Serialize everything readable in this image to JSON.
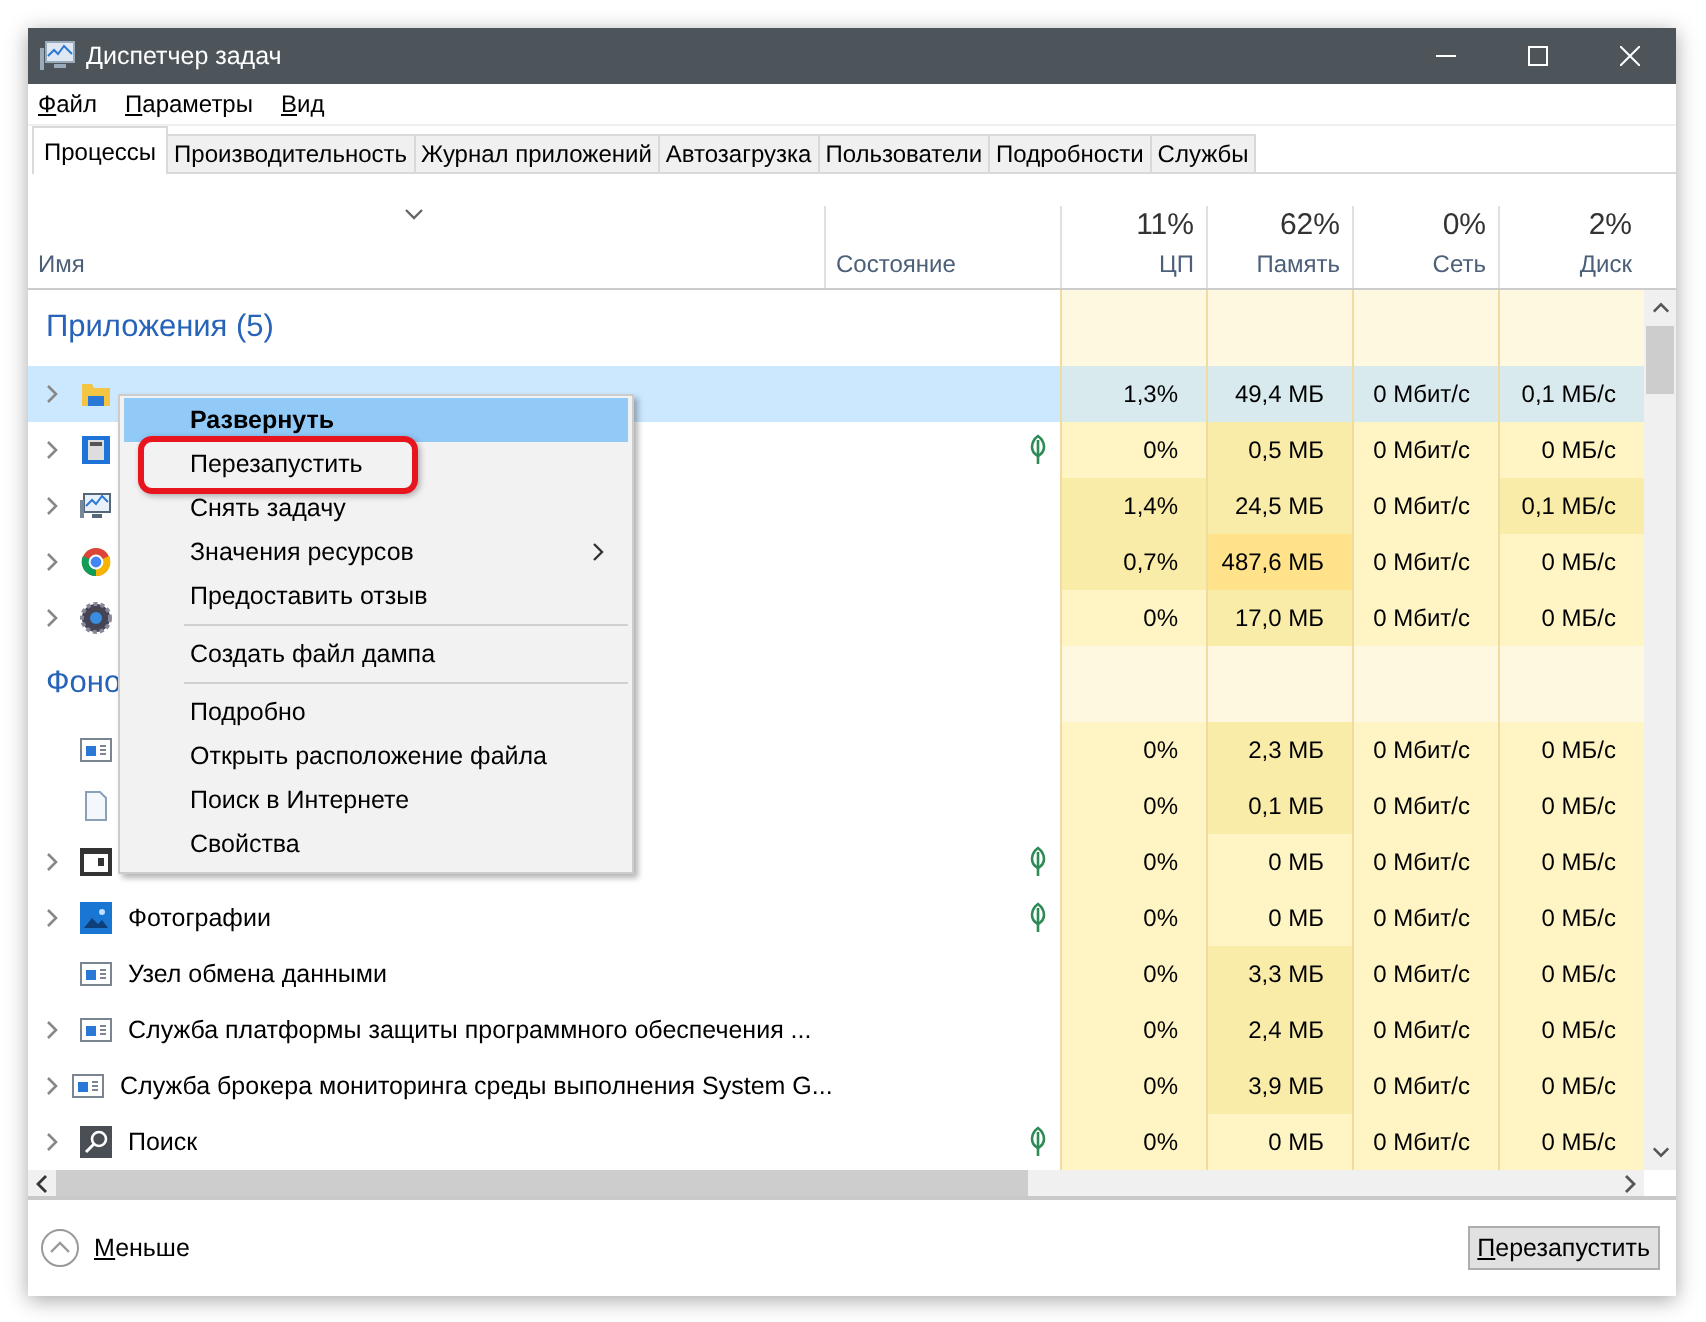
{
  "window": {
    "title": "Диспетчер задач"
  },
  "menu": [
    {
      "label": "Файл"
    },
    {
      "label": "Параметры"
    },
    {
      "label": "Вид"
    }
  ],
  "tabs": [
    {
      "label": "Процессы",
      "selected": true
    },
    {
      "label": "Производительность",
      "selected": false
    },
    {
      "label": "Журнал приложений",
      "selected": false
    },
    {
      "label": "Автозагрузка",
      "selected": false
    },
    {
      "label": "Пользователи",
      "selected": false
    },
    {
      "label": "Подробности",
      "selected": false
    },
    {
      "label": "Службы",
      "selected": false
    }
  ],
  "columns": [
    {
      "label": "Имя",
      "sorted": true
    },
    {
      "label": "Состояние",
      "sorted": false
    },
    {
      "label": "ЦП",
      "total": "11%",
      "sorted": false
    },
    {
      "label": "Память",
      "total": "62%",
      "sorted": false
    },
    {
      "label": "Сеть",
      "total": "0%",
      "sorted": false
    },
    {
      "label": "Диск",
      "total": "2%",
      "sorted": false
    }
  ],
  "groups": [
    {
      "title": "Приложения (5)",
      "rows": [
        {
          "kind": "folder",
          "expandable": true,
          "selected": true,
          "leaf": false,
          "cells": [
            {
              "text": "1,3%",
              "color": "#d8eaee"
            },
            {
              "text": "49,4 МБ",
              "color": "#d8eaee"
            },
            {
              "text": "0 Мбит/с",
              "color": "#d8eaee"
            },
            {
              "text": "0,1 МБ/с",
              "color": "#d8eaee"
            }
          ]
        },
        {
          "kind": "calculator",
          "expandable": true,
          "selected": false,
          "leaf": true,
          "cells": [
            {
              "text": "0%",
              "color": "#fff4c4"
            },
            {
              "text": "0,5 МБ",
              "color": "#f9eca8"
            },
            {
              "text": "0 Мбит/с",
              "color": "#fff4c4"
            },
            {
              "text": "0 МБ/с",
              "color": "#fff4c4"
            }
          ]
        },
        {
          "kind": "monitor",
          "expandable": true,
          "selected": false,
          "leaf": false,
          "cells": [
            {
              "text": "1,4%",
              "color": "#f9eca8"
            },
            {
              "text": "24,5 МБ",
              "color": "#f9eca8"
            },
            {
              "text": "0 Мбит/с",
              "color": "#fff4c4"
            },
            {
              "text": "0,1 МБ/с",
              "color": "#f9eca8"
            }
          ]
        },
        {
          "kind": "ring",
          "expandable": true,
          "selected": false,
          "leaf": false,
          "cells": [
            {
              "text": "0,7%",
              "color": "#f9eca8"
            },
            {
              "text": "487,6 МБ",
              "color": "#ffe28a"
            },
            {
              "text": "0 Мбит/с",
              "color": "#fff4c4"
            },
            {
              "text": "0 МБ/с",
              "color": "#fff4c4"
            }
          ]
        },
        {
          "kind": "gear",
          "expandable": true,
          "selected": false,
          "leaf": false,
          "cells": [
            {
              "text": "0%",
              "color": "#fff4c4"
            },
            {
              "text": "17,0 МБ",
              "color": "#f9eca8"
            },
            {
              "text": "0 Мбит/с",
              "color": "#fff4c4"
            },
            {
              "text": "0 МБ/с",
              "color": "#fff4c4"
            }
          ]
        }
      ]
    },
    {
      "title": "Фоно",
      "rows": [
        {
          "kind": "service",
          "expandable": false,
          "selected": false,
          "leaf": false,
          "cells": [
            {
              "text": "0%",
              "color": "#fff4c4"
            },
            {
              "text": "2,3 МБ",
              "color": "#f9eca8"
            },
            {
              "text": "0 Мбит/с",
              "color": "#fff4c4"
            },
            {
              "text": "0 МБ/с",
              "color": "#fff4c4"
            }
          ]
        },
        {
          "kind": "page",
          "expandable": false,
          "selected": false,
          "leaf": false,
          "cells": [
            {
              "text": "0%",
              "color": "#fff4c4"
            },
            {
              "text": "0,1 МБ",
              "color": "#f9eca8"
            },
            {
              "text": "0 Мбит/с",
              "color": "#fff4c4"
            },
            {
              "text": "0 МБ/с",
              "color": "#fff4c4"
            }
          ]
        },
        {
          "kind": "darkwindow",
          "expandable": true,
          "selected": false,
          "leaf": true,
          "cells": [
            {
              "text": "0%",
              "color": "#fff4c4"
            },
            {
              "text": "0 МБ",
              "color": "#fff4c4"
            },
            {
              "text": "0 Мбит/с",
              "color": "#fff4c4"
            },
            {
              "text": "0 МБ/с",
              "color": "#fff4c4"
            }
          ]
        },
        {
          "kind": "photo",
          "name": "Фотографии",
          "expandable": true,
          "selected": false,
          "leaf": true,
          "cells": [
            {
              "text": "0%",
              "color": "#fff4c4"
            },
            {
              "text": "0 МБ",
              "color": "#fff4c4"
            },
            {
              "text": "0 Мбит/с",
              "color": "#fff4c4"
            },
            {
              "text": "0 МБ/с",
              "color": "#fff4c4"
            }
          ]
        },
        {
          "kind": "service",
          "name": "Узел обмена данными",
          "expandable": false,
          "selected": false,
          "leaf": false,
          "cells": [
            {
              "text": "0%",
              "color": "#fff4c4"
            },
            {
              "text": "3,3 МБ",
              "color": "#f9eca8"
            },
            {
              "text": "0 Мбит/с",
              "color": "#fff4c4"
            },
            {
              "text": "0 МБ/с",
              "color": "#fff4c4"
            }
          ]
        },
        {
          "kind": "service",
          "name": "Служба платформы защиты программного обеспечения ...",
          "expandable": true,
          "selected": false,
          "leaf": false,
          "cells": [
            {
              "text": "0%",
              "color": "#fff4c4"
            },
            {
              "text": "2,4 МБ",
              "color": "#f9eca8"
            },
            {
              "text": "0 Мбит/с",
              "color": "#fff4c4"
            },
            {
              "text": "0 МБ/с",
              "color": "#fff4c4"
            }
          ]
        },
        {
          "kind": "service",
          "name": "Служба брокера мониторинга среды выполнения System G...",
          "expandable": true,
          "selected": false,
          "leaf": false,
          "cells": [
            {
              "text": "0%",
              "color": "#fff4c4"
            },
            {
              "text": "3,9 МБ",
              "color": "#f9eca8"
            },
            {
              "text": "0 Мбит/с",
              "color": "#fff4c4"
            },
            {
              "text": "0 МБ/с",
              "color": "#fff4c4"
            }
          ]
        },
        {
          "kind": "search",
          "name": "Поиск",
          "expandable": true,
          "selected": false,
          "leaf": true,
          "cells": [
            {
              "text": "0%",
              "color": "#fff4c4"
            },
            {
              "text": "0 МБ",
              "color": "#fff4c4"
            },
            {
              "text": "0 Мбит/с",
              "color": "#fff4c4"
            },
            {
              "text": "0 МБ/с",
              "color": "#fff4c4"
            }
          ]
        }
      ]
    }
  ],
  "context_menu": [
    {
      "kind": "item",
      "label": "Развернуть",
      "selected": true,
      "default": true,
      "highlighted": false
    },
    {
      "kind": "item",
      "label": "Перезапустить",
      "selected": false,
      "default": false,
      "highlighted": true
    },
    {
      "kind": "item",
      "label": "Снять задачу",
      "selected": false,
      "default": false,
      "highlighted": false
    },
    {
      "kind": "submenu",
      "label": "Значения ресурсов",
      "selected": false,
      "default": false,
      "highlighted": false
    },
    {
      "kind": "item",
      "label": "Предоставить отзыв",
      "selected": false,
      "default": false,
      "highlighted": false
    },
    {
      "kind": "separator"
    },
    {
      "kind": "item",
      "label": "Создать файл дампа",
      "selected": false,
      "default": false,
      "highlighted": false
    },
    {
      "kind": "separator"
    },
    {
      "kind": "item",
      "label": "Подробно",
      "selected": false,
      "default": false,
      "highlighted": false
    },
    {
      "kind": "item",
      "label": "Открыть расположение файла",
      "selected": false,
      "default": false,
      "highlighted": false
    },
    {
      "kind": "item",
      "label": "Поиск в Интернете",
      "selected": false,
      "default": false,
      "highlighted": false
    },
    {
      "kind": "item",
      "label": "Свойства",
      "selected": false,
      "default": false,
      "highlighted": false
    }
  ],
  "footer": {
    "less": "Меньше",
    "button": "Перезапустить"
  }
}
